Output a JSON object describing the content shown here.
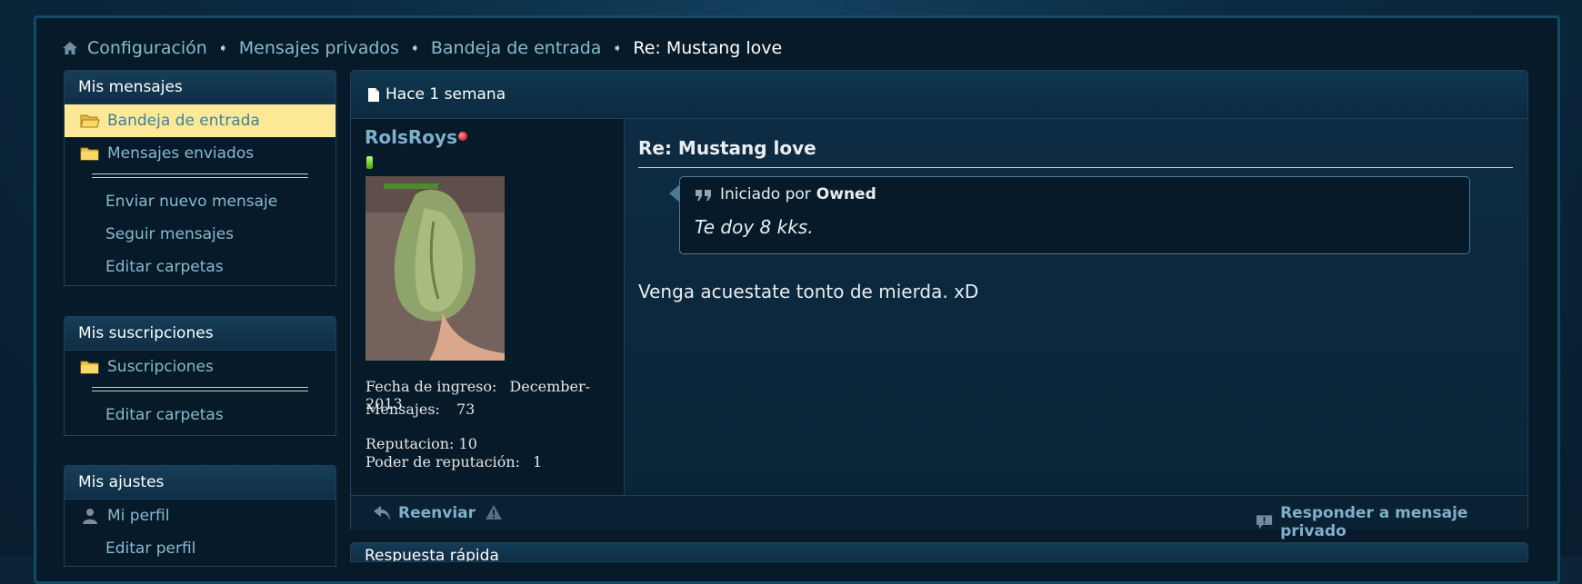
{
  "breadcrumb": {
    "items": [
      "Configuración",
      "Mensajes privados",
      "Bandeja de entrada"
    ],
    "current": "Re: Mustang love"
  },
  "sidebar": {
    "messages": {
      "title": "Mis mensajes",
      "folders": [
        "Bandeja de entrada",
        "Mensajes enviados"
      ],
      "links": [
        "Enviar nuevo mensaje",
        "Seguir mensajes",
        "Editar carpetas"
      ]
    },
    "subscriptions": {
      "title": "Mis suscripciones",
      "folders": [
        "Suscripciones"
      ],
      "links": [
        "Editar carpetas"
      ]
    },
    "settings": {
      "title": "Mis ajustes",
      "items": [
        "Mi perfil",
        "Editar perfil"
      ]
    }
  },
  "post": {
    "date": "Hace 1 semana",
    "user": {
      "name": "RolsRoys",
      "join_label": "Fecha de ingreso:",
      "join_value": "December-2013",
      "posts_label": "Mensajes:",
      "posts_value": "73",
      "rep_label": "Reputacion:",
      "rep_value": "10",
      "power_label": "Poder de reputación:",
      "power_value": "1"
    },
    "title": "Re: Mustang love",
    "quote": {
      "prefix": "Iniciado por",
      "author": "Owned",
      "text": "Te doy 8 kks."
    },
    "body": "Venga acuestate tonto de mierda. xD",
    "footer": {
      "forward": "Reenviar",
      "reply": "Responder a mensaje privado"
    }
  },
  "next_block": {
    "title": "Respuesta rápida"
  }
}
